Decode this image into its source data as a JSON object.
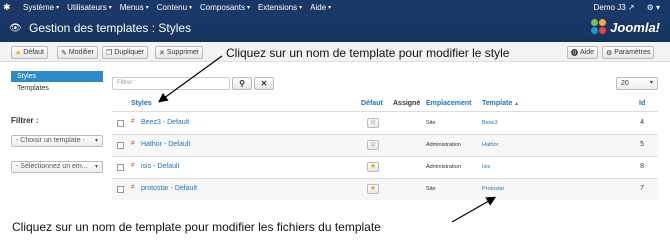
{
  "nav": {
    "items": [
      "Système",
      "Utilisateurs",
      "Menus",
      "Contenu",
      "Composants",
      "Extensions",
      "Aide"
    ],
    "user": "Demo J3"
  },
  "header": {
    "title": "Gestion des templates : Styles",
    "logo_text": "Joomla!"
  },
  "toolbar": {
    "default_label": "Défaut",
    "edit_label": "Modifier",
    "duplicate_label": "Dupliquer",
    "delete_label": "Supprimer",
    "help_label": "Aide",
    "options_label": "Paramètres"
  },
  "annotations": {
    "top": "Cliquez sur un nom de template pour modifier le style",
    "bottom": "Cliquez sur un nom de template pour modifier les fichiers du template"
  },
  "sidebar": {
    "items": [
      {
        "label": "Styles",
        "active": true
      },
      {
        "label": "Templates",
        "active": false
      }
    ],
    "filter_label": "Filtrer :",
    "template_select": "- Choisir un template -",
    "location_select": "- Sélectionnez un em..."
  },
  "search": {
    "placeholder": "Filtrer :",
    "search_icon": "search-icon",
    "clear_icon": "close-icon"
  },
  "list_limit": "20",
  "table": {
    "headers": {
      "styles": "Styles",
      "default": "Défaut",
      "assigned": "Assigné",
      "location": "Emplacement",
      "template": "Template",
      "id": "Id"
    },
    "rows": [
      {
        "style": "Beez3 - Default",
        "default": false,
        "location": "Site",
        "template": "Beez3",
        "id": "4"
      },
      {
        "style": "Hathor - Default",
        "default": false,
        "location": "Administration",
        "template": "Hathor",
        "id": "5"
      },
      {
        "style": "isis - Default",
        "default": true,
        "location": "Administration",
        "template": "Isis",
        "id": "8"
      },
      {
        "style": "protostar - Default",
        "default": true,
        "location": "Site",
        "template": "Protostar",
        "id": "7"
      }
    ]
  },
  "colors": {
    "navbar": "#1a3867",
    "link": "#1e74b9",
    "active_sidebar": "#2d8ac7",
    "default_star": "#f0a30a"
  }
}
